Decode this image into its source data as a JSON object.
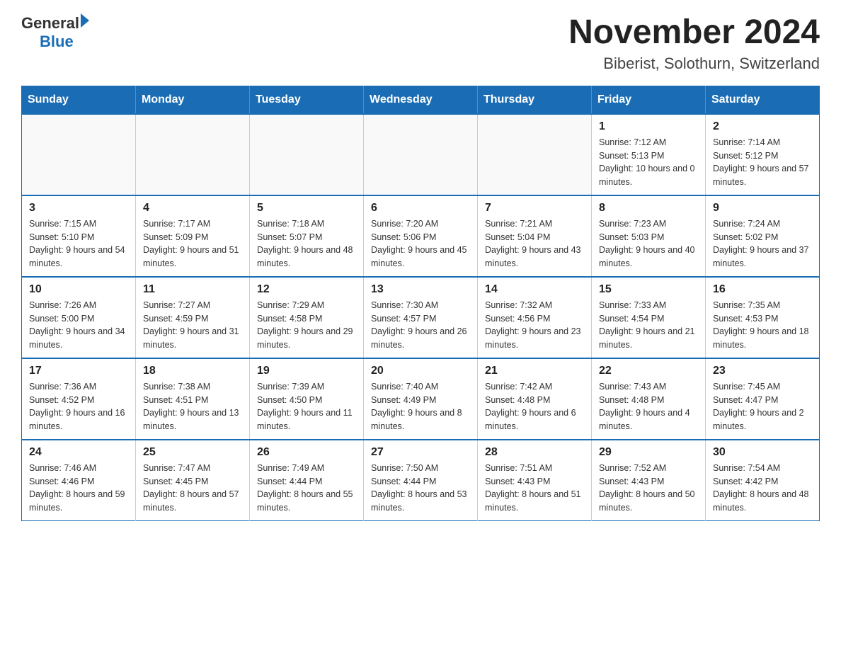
{
  "logo": {
    "general": "General",
    "triangle": "",
    "blue": "Blue"
  },
  "title": "November 2024",
  "subtitle": "Biberist, Solothurn, Switzerland",
  "days_of_week": [
    "Sunday",
    "Monday",
    "Tuesday",
    "Wednesday",
    "Thursday",
    "Friday",
    "Saturday"
  ],
  "weeks": [
    [
      {
        "day": "",
        "info": ""
      },
      {
        "day": "",
        "info": ""
      },
      {
        "day": "",
        "info": ""
      },
      {
        "day": "",
        "info": ""
      },
      {
        "day": "",
        "info": ""
      },
      {
        "day": "1",
        "info": "Sunrise: 7:12 AM\nSunset: 5:13 PM\nDaylight: 10 hours and 0 minutes."
      },
      {
        "day": "2",
        "info": "Sunrise: 7:14 AM\nSunset: 5:12 PM\nDaylight: 9 hours and 57 minutes."
      }
    ],
    [
      {
        "day": "3",
        "info": "Sunrise: 7:15 AM\nSunset: 5:10 PM\nDaylight: 9 hours and 54 minutes."
      },
      {
        "day": "4",
        "info": "Sunrise: 7:17 AM\nSunset: 5:09 PM\nDaylight: 9 hours and 51 minutes."
      },
      {
        "day": "5",
        "info": "Sunrise: 7:18 AM\nSunset: 5:07 PM\nDaylight: 9 hours and 48 minutes."
      },
      {
        "day": "6",
        "info": "Sunrise: 7:20 AM\nSunset: 5:06 PM\nDaylight: 9 hours and 45 minutes."
      },
      {
        "day": "7",
        "info": "Sunrise: 7:21 AM\nSunset: 5:04 PM\nDaylight: 9 hours and 43 minutes."
      },
      {
        "day": "8",
        "info": "Sunrise: 7:23 AM\nSunset: 5:03 PM\nDaylight: 9 hours and 40 minutes."
      },
      {
        "day": "9",
        "info": "Sunrise: 7:24 AM\nSunset: 5:02 PM\nDaylight: 9 hours and 37 minutes."
      }
    ],
    [
      {
        "day": "10",
        "info": "Sunrise: 7:26 AM\nSunset: 5:00 PM\nDaylight: 9 hours and 34 minutes."
      },
      {
        "day": "11",
        "info": "Sunrise: 7:27 AM\nSunset: 4:59 PM\nDaylight: 9 hours and 31 minutes."
      },
      {
        "day": "12",
        "info": "Sunrise: 7:29 AM\nSunset: 4:58 PM\nDaylight: 9 hours and 29 minutes."
      },
      {
        "day": "13",
        "info": "Sunrise: 7:30 AM\nSunset: 4:57 PM\nDaylight: 9 hours and 26 minutes."
      },
      {
        "day": "14",
        "info": "Sunrise: 7:32 AM\nSunset: 4:56 PM\nDaylight: 9 hours and 23 minutes."
      },
      {
        "day": "15",
        "info": "Sunrise: 7:33 AM\nSunset: 4:54 PM\nDaylight: 9 hours and 21 minutes."
      },
      {
        "day": "16",
        "info": "Sunrise: 7:35 AM\nSunset: 4:53 PM\nDaylight: 9 hours and 18 minutes."
      }
    ],
    [
      {
        "day": "17",
        "info": "Sunrise: 7:36 AM\nSunset: 4:52 PM\nDaylight: 9 hours and 16 minutes."
      },
      {
        "day": "18",
        "info": "Sunrise: 7:38 AM\nSunset: 4:51 PM\nDaylight: 9 hours and 13 minutes."
      },
      {
        "day": "19",
        "info": "Sunrise: 7:39 AM\nSunset: 4:50 PM\nDaylight: 9 hours and 11 minutes."
      },
      {
        "day": "20",
        "info": "Sunrise: 7:40 AM\nSunset: 4:49 PM\nDaylight: 9 hours and 8 minutes."
      },
      {
        "day": "21",
        "info": "Sunrise: 7:42 AM\nSunset: 4:48 PM\nDaylight: 9 hours and 6 minutes."
      },
      {
        "day": "22",
        "info": "Sunrise: 7:43 AM\nSunset: 4:48 PM\nDaylight: 9 hours and 4 minutes."
      },
      {
        "day": "23",
        "info": "Sunrise: 7:45 AM\nSunset: 4:47 PM\nDaylight: 9 hours and 2 minutes."
      }
    ],
    [
      {
        "day": "24",
        "info": "Sunrise: 7:46 AM\nSunset: 4:46 PM\nDaylight: 8 hours and 59 minutes."
      },
      {
        "day": "25",
        "info": "Sunrise: 7:47 AM\nSunset: 4:45 PM\nDaylight: 8 hours and 57 minutes."
      },
      {
        "day": "26",
        "info": "Sunrise: 7:49 AM\nSunset: 4:44 PM\nDaylight: 8 hours and 55 minutes."
      },
      {
        "day": "27",
        "info": "Sunrise: 7:50 AM\nSunset: 4:44 PM\nDaylight: 8 hours and 53 minutes."
      },
      {
        "day": "28",
        "info": "Sunrise: 7:51 AM\nSunset: 4:43 PM\nDaylight: 8 hours and 51 minutes."
      },
      {
        "day": "29",
        "info": "Sunrise: 7:52 AM\nSunset: 4:43 PM\nDaylight: 8 hours and 50 minutes."
      },
      {
        "day": "30",
        "info": "Sunrise: 7:54 AM\nSunset: 4:42 PM\nDaylight: 8 hours and 48 minutes."
      }
    ]
  ]
}
